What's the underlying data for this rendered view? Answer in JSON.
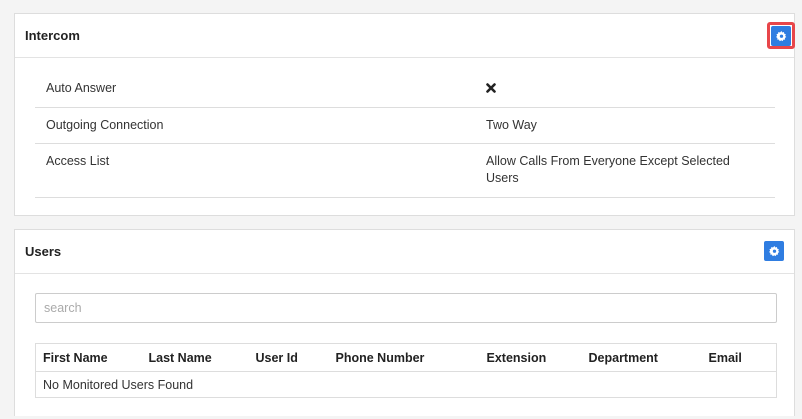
{
  "intercom": {
    "title": "Intercom",
    "settings_icon": "gear-icon",
    "rows": [
      {
        "label": "Auto Answer",
        "value_icon": "x-icon"
      },
      {
        "label": "Outgoing Connection",
        "value": "Two Way"
      },
      {
        "label": "Access List",
        "value": "Allow Calls From Everyone Except Selected Users"
      }
    ]
  },
  "users": {
    "title": "Users",
    "settings_icon": "gear-icon",
    "search": {
      "placeholder": "search",
      "value": ""
    },
    "columns": [
      "First Name",
      "Last Name",
      "User Id",
      "Phone Number",
      "Extension",
      "Department",
      "Email"
    ],
    "empty_message": "No Monitored Users Found"
  },
  "colors": {
    "accent": "#2f7de1",
    "highlight": "#e8464a",
    "background": "#f4f4f4"
  }
}
